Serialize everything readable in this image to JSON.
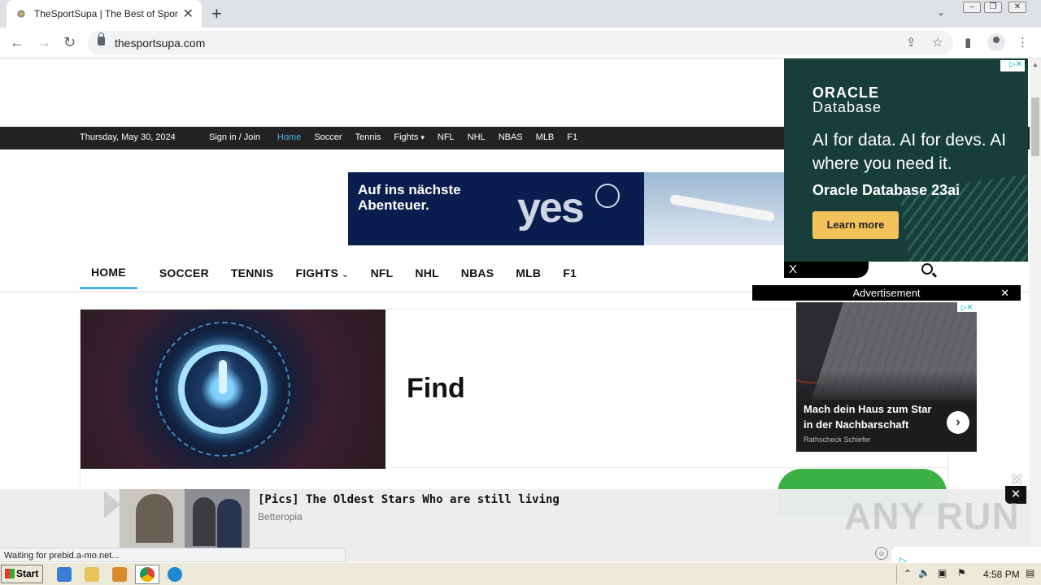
{
  "browser": {
    "tab_title": "TheSportSupa | The Best of Sports N",
    "url": "thesportsupa.com",
    "status": "Waiting for prebid.a-mo.net..."
  },
  "topbar": {
    "date": "Thursday, May 30, 2024",
    "signin": "Sign in / Join",
    "links": [
      "Home",
      "Soccer",
      "Tennis",
      "Fights",
      "NFL",
      "NHL",
      "NBAS",
      "MLB",
      "F1"
    ]
  },
  "banner": {
    "text": "Auf ins nächste Abenteuer.",
    "brand": "yes"
  },
  "mainnav": {
    "items": [
      "HOME",
      "SOCCER",
      "TENNIS",
      "FIGHTS",
      "NFL",
      "NHL",
      "NBAS",
      "MLB",
      "F1"
    ]
  },
  "hero": {
    "title": "Find"
  },
  "oracle_ad": {
    "logo_line1": "ORACLE",
    "logo_line2": "Database",
    "headline": "AI for data. AI for devs. AI where you need it.",
    "product": "Oracle Database 23ai",
    "cta": "Learn more",
    "close": "X"
  },
  "side_ad": {
    "label": "Advertisement",
    "close": "✕",
    "title": "Mach dein Haus zum Star in der Nachbarschaft",
    "sponsor": "Rathscheck Schiefer"
  },
  "bottom_ad": {
    "headline": "[Pics] The Oldest Stars Who are still living",
    "source": "Betteropia",
    "close": "✕"
  },
  "watermark": "ANY RUN",
  "taskbar": {
    "start": "Start",
    "time": "4:58 PM"
  }
}
